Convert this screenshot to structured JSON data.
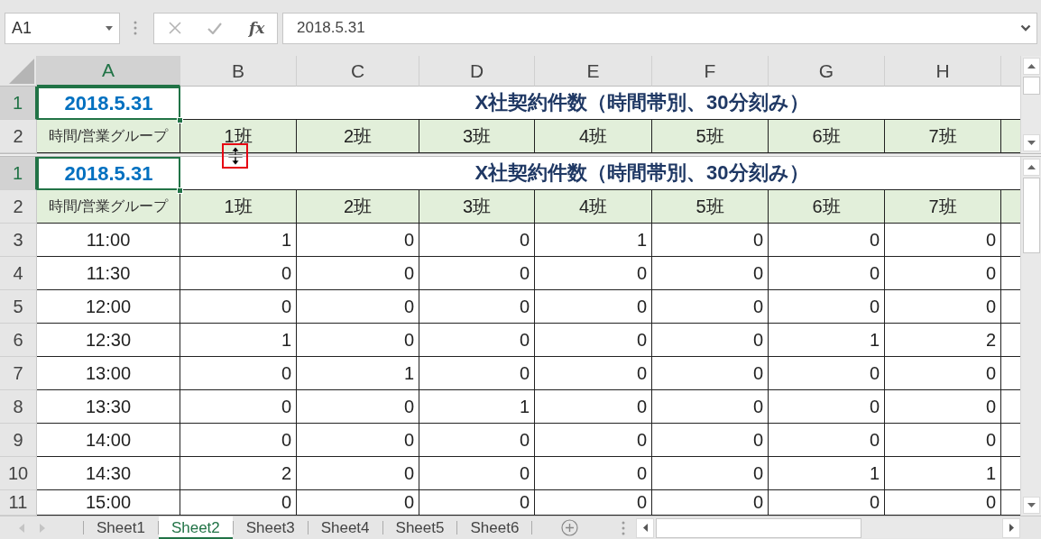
{
  "name_box": {
    "value": "A1"
  },
  "formula_bar": {
    "function_label": "fx",
    "value": "2018.5.31"
  },
  "column_headers": [
    {
      "label": "A",
      "selected": true
    },
    {
      "label": "B",
      "selected": false
    },
    {
      "label": "C",
      "selected": false
    },
    {
      "label": "D",
      "selected": false
    },
    {
      "label": "E",
      "selected": false
    },
    {
      "label": "F",
      "selected": false
    },
    {
      "label": "G",
      "selected": false
    },
    {
      "label": "H",
      "selected": false
    }
  ],
  "panes": [
    {
      "rows": [
        {
          "kind": "title",
          "number": "1",
          "selected": true,
          "date": "2018.5.31",
          "title": "X社契約件数（時間帯別、30分刻み）"
        },
        {
          "kind": "groups",
          "number": "2",
          "selected": false,
          "label": "時間/営業グループ",
          "groups": [
            "1班",
            "2班",
            "3班",
            "4班",
            "5班",
            "6班",
            "7班"
          ]
        }
      ]
    },
    {
      "rows": [
        {
          "kind": "title",
          "number": "1",
          "selected": true,
          "date": "2018.5.31",
          "title": "X社契約件数（時間帯別、30分刻み）"
        },
        {
          "kind": "groups",
          "number": "2",
          "selected": false,
          "label": "時間/営業グループ",
          "groups": [
            "1班",
            "2班",
            "3班",
            "4班",
            "5班",
            "6班",
            "7班"
          ]
        },
        {
          "kind": "data",
          "number": "3",
          "selected": false,
          "time": "11:00",
          "values": [
            "1",
            "0",
            "0",
            "1",
            "0",
            "0",
            "0"
          ]
        },
        {
          "kind": "data",
          "number": "4",
          "selected": false,
          "time": "11:30",
          "values": [
            "0",
            "0",
            "0",
            "0",
            "0",
            "0",
            "0"
          ]
        },
        {
          "kind": "data",
          "number": "5",
          "selected": false,
          "time": "12:00",
          "values": [
            "0",
            "0",
            "0",
            "0",
            "0",
            "0",
            "0"
          ]
        },
        {
          "kind": "data",
          "number": "6",
          "selected": false,
          "time": "12:30",
          "values": [
            "1",
            "0",
            "0",
            "0",
            "0",
            "1",
            "2"
          ]
        },
        {
          "kind": "data",
          "number": "7",
          "selected": false,
          "time": "13:00",
          "values": [
            "0",
            "1",
            "0",
            "0",
            "0",
            "0",
            "0"
          ]
        },
        {
          "kind": "data",
          "number": "8",
          "selected": false,
          "time": "13:30",
          "values": [
            "0",
            "0",
            "1",
            "0",
            "0",
            "0",
            "0"
          ]
        },
        {
          "kind": "data",
          "number": "9",
          "selected": false,
          "time": "14:00",
          "values": [
            "0",
            "0",
            "0",
            "0",
            "0",
            "0",
            "0"
          ]
        },
        {
          "kind": "data",
          "number": "10",
          "selected": false,
          "time": "14:30",
          "values": [
            "2",
            "0",
            "0",
            "0",
            "0",
            "1",
            "1"
          ]
        },
        {
          "kind": "data",
          "number": "11",
          "selected": false,
          "time": "15:00",
          "values": [
            "0",
            "0",
            "0",
            "0",
            "0",
            "0",
            "0"
          ]
        }
      ]
    }
  ],
  "sheet_tabs": [
    {
      "label": "Sheet1",
      "selected": false
    },
    {
      "label": "Sheet2",
      "selected": true
    },
    {
      "label": "Sheet3",
      "selected": false
    },
    {
      "label": "Sheet4",
      "selected": false
    },
    {
      "label": "Sheet5",
      "selected": false
    },
    {
      "label": "Sheet6",
      "selected": false
    }
  ]
}
